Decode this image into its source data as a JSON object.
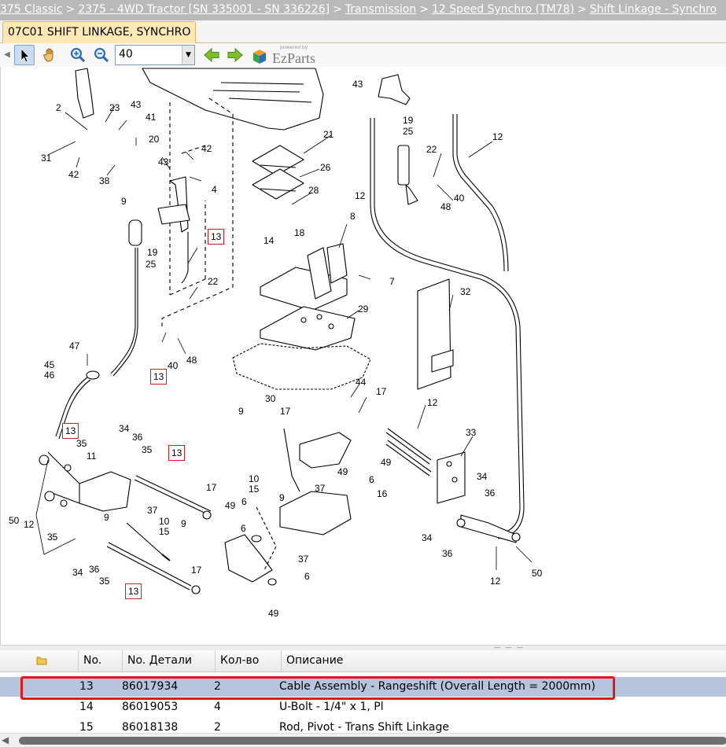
{
  "breadcrumb": {
    "items": [
      "375 Classic",
      "2375 - 4WD Tractor [SN 335001 - SN 336226]",
      "Transmission",
      "12 Speed Synchro (TM78)",
      "Shift Linkage - Synchro"
    ],
    "separator": ">"
  },
  "tab": {
    "label": "07C01 SHIFT LINKAGE, SYNCHRO"
  },
  "toolbar": {
    "zoom_value": "40",
    "logo_small": "powered by",
    "logo_text": "EzParts"
  },
  "diagram": {
    "labels": [
      "2",
      "23",
      "43",
      "41",
      "20",
      "31",
      "42",
      "38",
      "43",
      "42",
      "4",
      "9",
      "13",
      "19",
      "25",
      "22",
      "40",
      "48",
      "47",
      "45",
      "46",
      "13",
      "43",
      "19",
      "25",
      "12",
      "22",
      "48",
      "40",
      "12",
      "21",
      "26",
      "28",
      "8",
      "18",
      "14",
      "7",
      "32",
      "29",
      "30",
      "44",
      "17",
      "9",
      "17",
      "12",
      "10",
      "15",
      "9",
      "34",
      "36",
      "35",
      "13",
      "13",
      "35",
      "11",
      "50",
      "35",
      "17",
      "9",
      "37",
      "10",
      "15",
      "9",
      "6",
      "49",
      "37",
      "16",
      "49",
      "49",
      "6",
      "33",
      "34",
      "36",
      "50",
      "34",
      "36",
      "12",
      "6",
      "37",
      "49",
      "34",
      "36",
      "35",
      "13",
      "17",
      "12",
      "6"
    ],
    "boxed_callouts": [
      "13",
      "13",
      "13",
      "13",
      "13"
    ]
  },
  "table": {
    "columns": {
      "icon": "",
      "no": "No.",
      "part_no": "No. Детали",
      "qty": "Кол-во",
      "desc": "Описание"
    },
    "rows": [
      {
        "no": "13",
        "part_no": "86017934",
        "qty": "2",
        "desc": "Cable Assembly - Rangeshift (Overall Length = 2000mm)",
        "selected": true
      },
      {
        "no": "14",
        "part_no": "86019053",
        "qty": "4",
        "desc": "U-Bolt - 1/4\" x 1, Pl",
        "selected": false
      },
      {
        "no": "15",
        "part_no": "86018138",
        "qty": "2",
        "desc": "Rod, Pivot - Trans Shift Linkage",
        "selected": false
      }
    ]
  },
  "colors": {
    "breadcrumb_bg": "#b9b9b9",
    "tab_bg": "#ffe9b3",
    "selected_row": "#b6c4de",
    "highlight": "#e51515"
  }
}
